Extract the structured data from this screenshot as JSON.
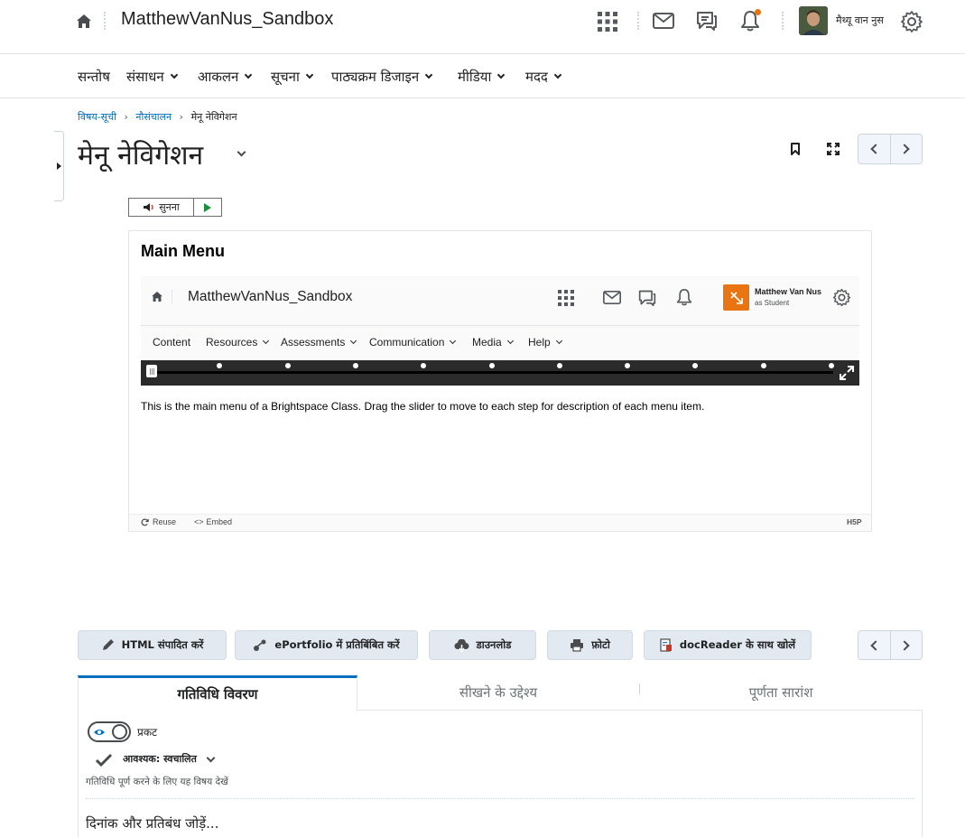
{
  "topbar": {
    "course_title": "MatthewVanNus_Sandbox",
    "user_name": "मैथ्यू वान नुस",
    "icons": [
      "home-icon",
      "apps-grid-icon",
      "mail-icon",
      "chat-icon",
      "bell-icon",
      "gear-icon"
    ],
    "notification_color": "#e87511"
  },
  "navbar": {
    "items": [
      {
        "label": "सन्तोष",
        "dropdown": false
      },
      {
        "label": "संसाधन",
        "dropdown": true
      },
      {
        "label": "आकलन",
        "dropdown": true
      },
      {
        "label": "सूचना",
        "dropdown": true
      },
      {
        "label": "पाठ्यक्रम डिजाइन",
        "dropdown": true
      },
      {
        "label": "मीडिया",
        "dropdown": true
      },
      {
        "label": "मदद",
        "dropdown": true
      }
    ]
  },
  "breadcrumb": {
    "items": [
      "विषय-सूची",
      "नौसंचालन",
      "मेनू नेविगेशन"
    ]
  },
  "page": {
    "title": "मेनू नेविगेशन"
  },
  "listen": {
    "label": "सुनना"
  },
  "h5p": {
    "heading": "Main Menu",
    "inner": {
      "course_title": "MatthewVanNus_Sandbox",
      "user_name": "Matthew Van Nus",
      "user_role": "as Student",
      "accent_color": "#e87511",
      "nav": [
        "Content",
        "Resources",
        "Assessments",
        "Communication",
        "Media",
        "Help"
      ]
    },
    "slider": {
      "steps": 11,
      "current_step": 1
    },
    "description": "This is the main menu of a Brightspace Class. Drag the slider to move to each step for description of each menu item.",
    "footer": {
      "reuse": "Reuse",
      "embed": "Embed",
      "brand": "H5P"
    }
  },
  "actions": {
    "edit_html": "HTML संपादित करें",
    "eportfolio": "ePortfolio में प्रतिबिंबित करें",
    "download": "डाउनलोड",
    "print": "फ़ोटो",
    "docreader": "docReader के साथ खोलें"
  },
  "tabs": [
    {
      "label": "गतिविधि विवरण",
      "active": true
    },
    {
      "label": "सीखने के उद्देश्य",
      "active": false
    },
    {
      "label": "पूर्णता सारांश",
      "active": false
    }
  ],
  "activity": {
    "visibility_label": "प्रकट",
    "requirement_label": "आवश्यक: स्वचालित",
    "requirement_hint": "गतिविधि पूर्ण करने के लिए यह विषय देखें",
    "add_dates": "दिनांक और प्रतिबंध जोड़ें..."
  },
  "colors": {
    "link": "#006fbf",
    "tab_active_border": "#006fbf",
    "toggle": "#006fbf"
  }
}
